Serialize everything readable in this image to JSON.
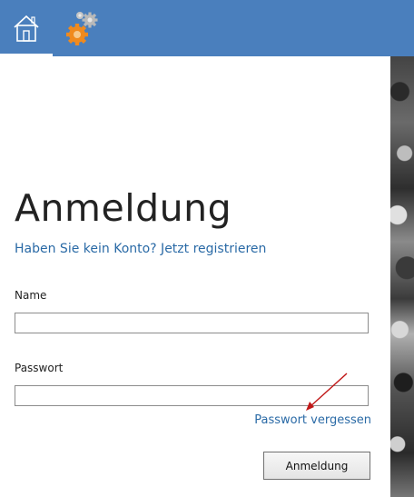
{
  "header": {
    "home_icon": "home-icon",
    "settings_icon": "gears-icon",
    "accent": "#4a7fbd"
  },
  "login": {
    "title": "Anmeldung",
    "register_link": "Haben Sie kein Konto? Jetzt registrieren",
    "name_label": "Name",
    "name_value": "",
    "password_label": "Passwort",
    "password_value": "",
    "forgot_link": "Passwort vergessen",
    "submit_label": "Anmeldung",
    "link_color": "#2a6aa6"
  }
}
